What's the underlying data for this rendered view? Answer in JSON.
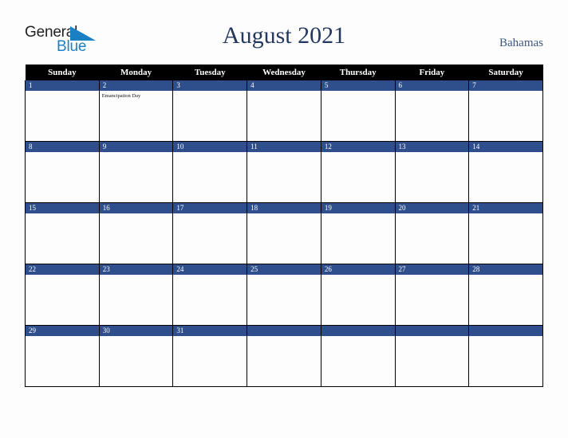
{
  "logo": {
    "text_top": "General",
    "text_bottom": "Blue",
    "triangle_icon": "triangle-icon",
    "color_top": "#222222",
    "color_bottom": "#1b7fc4",
    "triangle_color": "#1b7fc4"
  },
  "header": {
    "title": "August 2021",
    "country": "Bahamas",
    "title_color": "#24375f",
    "country_color": "#3c5580"
  },
  "calendar": {
    "accent_color": "#2f4f8c",
    "header_bg": "#000000",
    "weekday_headers": [
      "Sunday",
      "Monday",
      "Tuesday",
      "Wednesday",
      "Thursday",
      "Friday",
      "Saturday"
    ],
    "weeks": [
      [
        {
          "day": "1",
          "events": []
        },
        {
          "day": "2",
          "events": [
            "Emancipation Day"
          ]
        },
        {
          "day": "3",
          "events": []
        },
        {
          "day": "4",
          "events": []
        },
        {
          "day": "5",
          "events": []
        },
        {
          "day": "6",
          "events": []
        },
        {
          "day": "7",
          "events": []
        }
      ],
      [
        {
          "day": "8",
          "events": []
        },
        {
          "day": "9",
          "events": []
        },
        {
          "day": "10",
          "events": []
        },
        {
          "day": "11",
          "events": []
        },
        {
          "day": "12",
          "events": []
        },
        {
          "day": "13",
          "events": []
        },
        {
          "day": "14",
          "events": []
        }
      ],
      [
        {
          "day": "15",
          "events": []
        },
        {
          "day": "16",
          "events": []
        },
        {
          "day": "17",
          "events": []
        },
        {
          "day": "18",
          "events": []
        },
        {
          "day": "19",
          "events": []
        },
        {
          "day": "20",
          "events": []
        },
        {
          "day": "21",
          "events": []
        }
      ],
      [
        {
          "day": "22",
          "events": []
        },
        {
          "day": "23",
          "events": []
        },
        {
          "day": "24",
          "events": []
        },
        {
          "day": "25",
          "events": []
        },
        {
          "day": "26",
          "events": []
        },
        {
          "day": "27",
          "events": []
        },
        {
          "day": "28",
          "events": []
        }
      ],
      [
        {
          "day": "29",
          "events": []
        },
        {
          "day": "30",
          "events": []
        },
        {
          "day": "31",
          "events": []
        },
        {
          "day": "",
          "events": []
        },
        {
          "day": "",
          "events": []
        },
        {
          "day": "",
          "events": []
        },
        {
          "day": "",
          "events": []
        }
      ]
    ]
  }
}
